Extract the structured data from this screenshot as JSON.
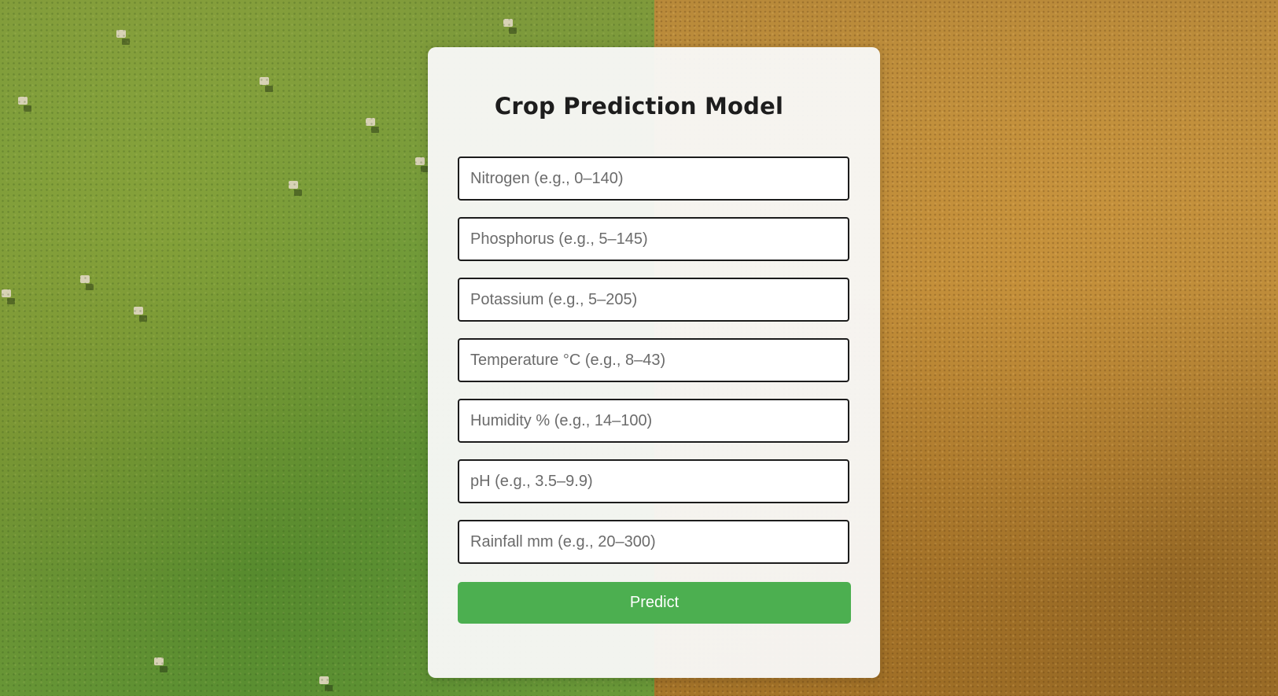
{
  "form": {
    "title": "Crop Prediction Model",
    "fields": [
      {
        "placeholder": "Nitrogen (e.g., 0–140)",
        "value": ""
      },
      {
        "placeholder": "Phosphorus (e.g., 5–145)",
        "value": ""
      },
      {
        "placeholder": "Potassium (e.g., 5–205)",
        "value": ""
      },
      {
        "placeholder": "Temperature °C (e.g., 8–43)",
        "value": ""
      },
      {
        "placeholder": "Humidity % (e.g., 14–100)",
        "value": ""
      },
      {
        "placeholder": "pH (e.g., 3.5–9.9)",
        "value": ""
      },
      {
        "placeholder": "Rainfall mm (e.g., 20–300)",
        "value": ""
      }
    ],
    "submit_label": "Predict"
  },
  "colors": {
    "accent": "#4caf50",
    "card_background": "#f8f8f7",
    "field_border": "#1c1c1c"
  }
}
